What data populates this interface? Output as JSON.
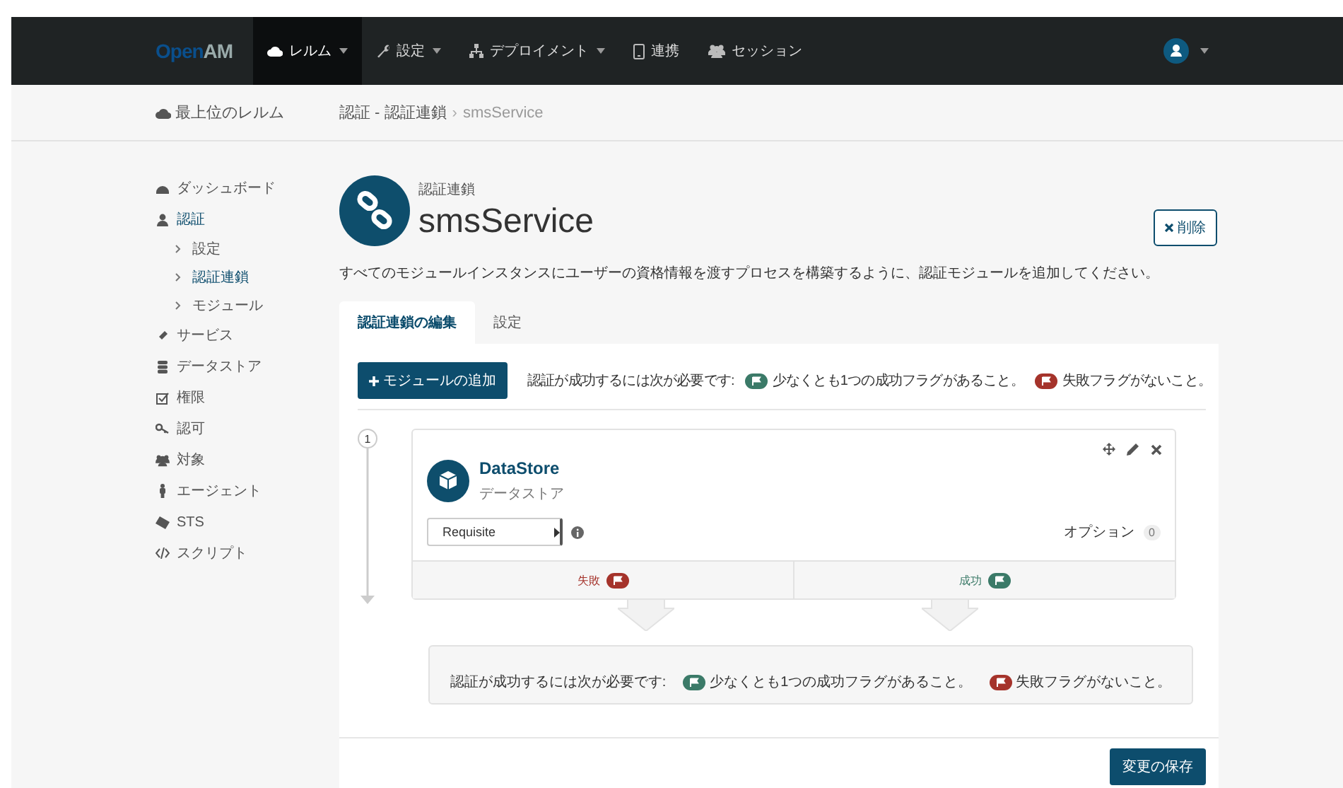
{
  "navbar": {
    "logo": {
      "first": "Open",
      "second": "AM"
    },
    "menu": [
      {
        "label": "レルム",
        "selected": true,
        "dropdown": true
      },
      {
        "label": "設定",
        "selected": false,
        "dropdown": true
      },
      {
        "label": "デプロイメント",
        "selected": false,
        "dropdown": true
      },
      {
        "label": "連携",
        "selected": false,
        "dropdown": false
      },
      {
        "label": "セッション",
        "selected": false,
        "dropdown": false
      }
    ]
  },
  "breadcrumb": {
    "home": "最上位のレルム",
    "path": "認証 - 認証連鎖",
    "separator": "›",
    "current": "smsService"
  },
  "sidebar": [
    {
      "label": "ダッシュボード",
      "selected": false
    },
    {
      "label": "認証",
      "selected": true,
      "children": [
        {
          "label": "設定",
          "selected": false
        },
        {
          "label": "認証連鎖",
          "selected": true
        },
        {
          "label": "モジュール",
          "selected": false
        }
      ]
    },
    {
      "label": "サービス",
      "selected": false
    },
    {
      "label": "データストア",
      "selected": false
    },
    {
      "label": "権限",
      "selected": false
    },
    {
      "label": "認可",
      "selected": false
    },
    {
      "label": "対象",
      "selected": false
    },
    {
      "label": "エージェント",
      "selected": false
    },
    {
      "label": "STS",
      "selected": false
    },
    {
      "label": "スクリプト",
      "selected": false
    }
  ],
  "header": {
    "subtitle": "認証連鎖",
    "title": "smsService",
    "delete_button": "削除",
    "description": "すべてのモジュールインスタンスにユーザーの資格情報を渡すプロセスを構築するように、認証モジュールを追加してください。"
  },
  "tabs": [
    {
      "label": "認証連鎖の編集",
      "selected": true
    },
    {
      "label": "設定",
      "selected": false
    }
  ],
  "toolbar": {
    "add_button": "モジュールの追加",
    "requirement": {
      "lead": "認証が成功するには次が必要です:",
      "success": "少なくとも1つの成功フラグがあること。",
      "failure": "失敗フラグがないこと。"
    }
  },
  "chain": [
    {
      "number": "1",
      "name": "DataStore",
      "type": "データストア",
      "criteria": "Requisite",
      "options_label": "オプション",
      "options_count": "0",
      "failure_label": "失敗",
      "success_label": "成功"
    }
  ],
  "summary": {
    "lead": "認証が成功するには次が必要です:",
    "success": "少なくとも1つの成功フラグがあること。",
    "failure": "失敗フラグがないこと。"
  },
  "save_button": "変更の保存"
}
